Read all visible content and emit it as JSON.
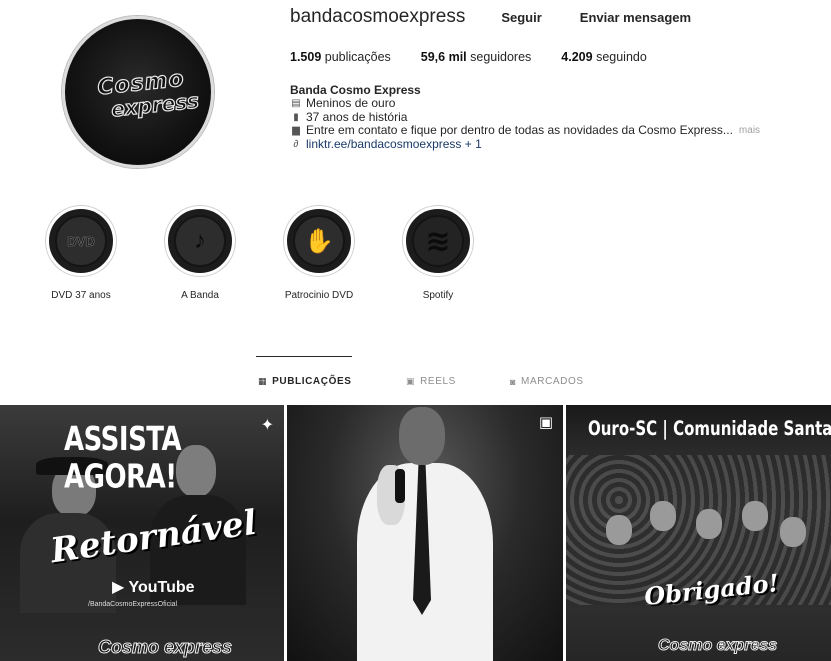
{
  "profile": {
    "username": "bandacosmoexpress",
    "follow_label": "Seguir",
    "message_label": "Enviar mensagem",
    "avatar_logo_line1": "Cosmo",
    "avatar_logo_line2": "express",
    "stats": [
      {
        "value": "1.509",
        "label": "publicações"
      },
      {
        "value": "59,6 mil",
        "label": "seguidores"
      },
      {
        "value": "4.209",
        "label": "seguindo"
      }
    ],
    "bio": {
      "name": "Banda Cosmo Express",
      "lines": [
        "Meninos de ouro",
        "37 anos de história",
        "Entre em contato e fique por dentro de todas as novidades da Cosmo Express..."
      ],
      "more": "mais",
      "link": "linktr.ee/bandacosmoexpress + 1"
    }
  },
  "highlights": [
    {
      "label": "DVD 37 anos",
      "icon": "dvd-icon",
      "glyph": "DVD"
    },
    {
      "label": "A Banda",
      "icon": "drummer-icon",
      "glyph": "♪"
    },
    {
      "label": "Patrocinio DVD",
      "icon": "handshake-icon",
      "glyph": "✋"
    },
    {
      "label": "Spotify",
      "icon": "spotify-icon",
      "glyph": "≋"
    }
  ],
  "tabs": [
    {
      "label": "PUBLICAÇÕES",
      "icon": "grid-icon",
      "glyph": "▦",
      "active": true
    },
    {
      "label": "REELS",
      "icon": "reels-icon",
      "glyph": "▣",
      "active": false
    },
    {
      "label": "MARCADOS",
      "icon": "tagged-icon",
      "glyph": "◙",
      "active": false
    }
  ],
  "posts": [
    {
      "headline": "ASSISTA AGORA!",
      "script": "Retornável",
      "platform": "▶ YouTube",
      "handle": "/BandaCosmoExpressOficial",
      "logo": "Cosmo express",
      "badge": "pin-icon"
    },
    {
      "badge": "reels-icon"
    },
    {
      "headline": "Ouro-SC | Comunidade Santa lúcia",
      "script": "Obrigado!",
      "logo": "Cosmo express"
    }
  ]
}
